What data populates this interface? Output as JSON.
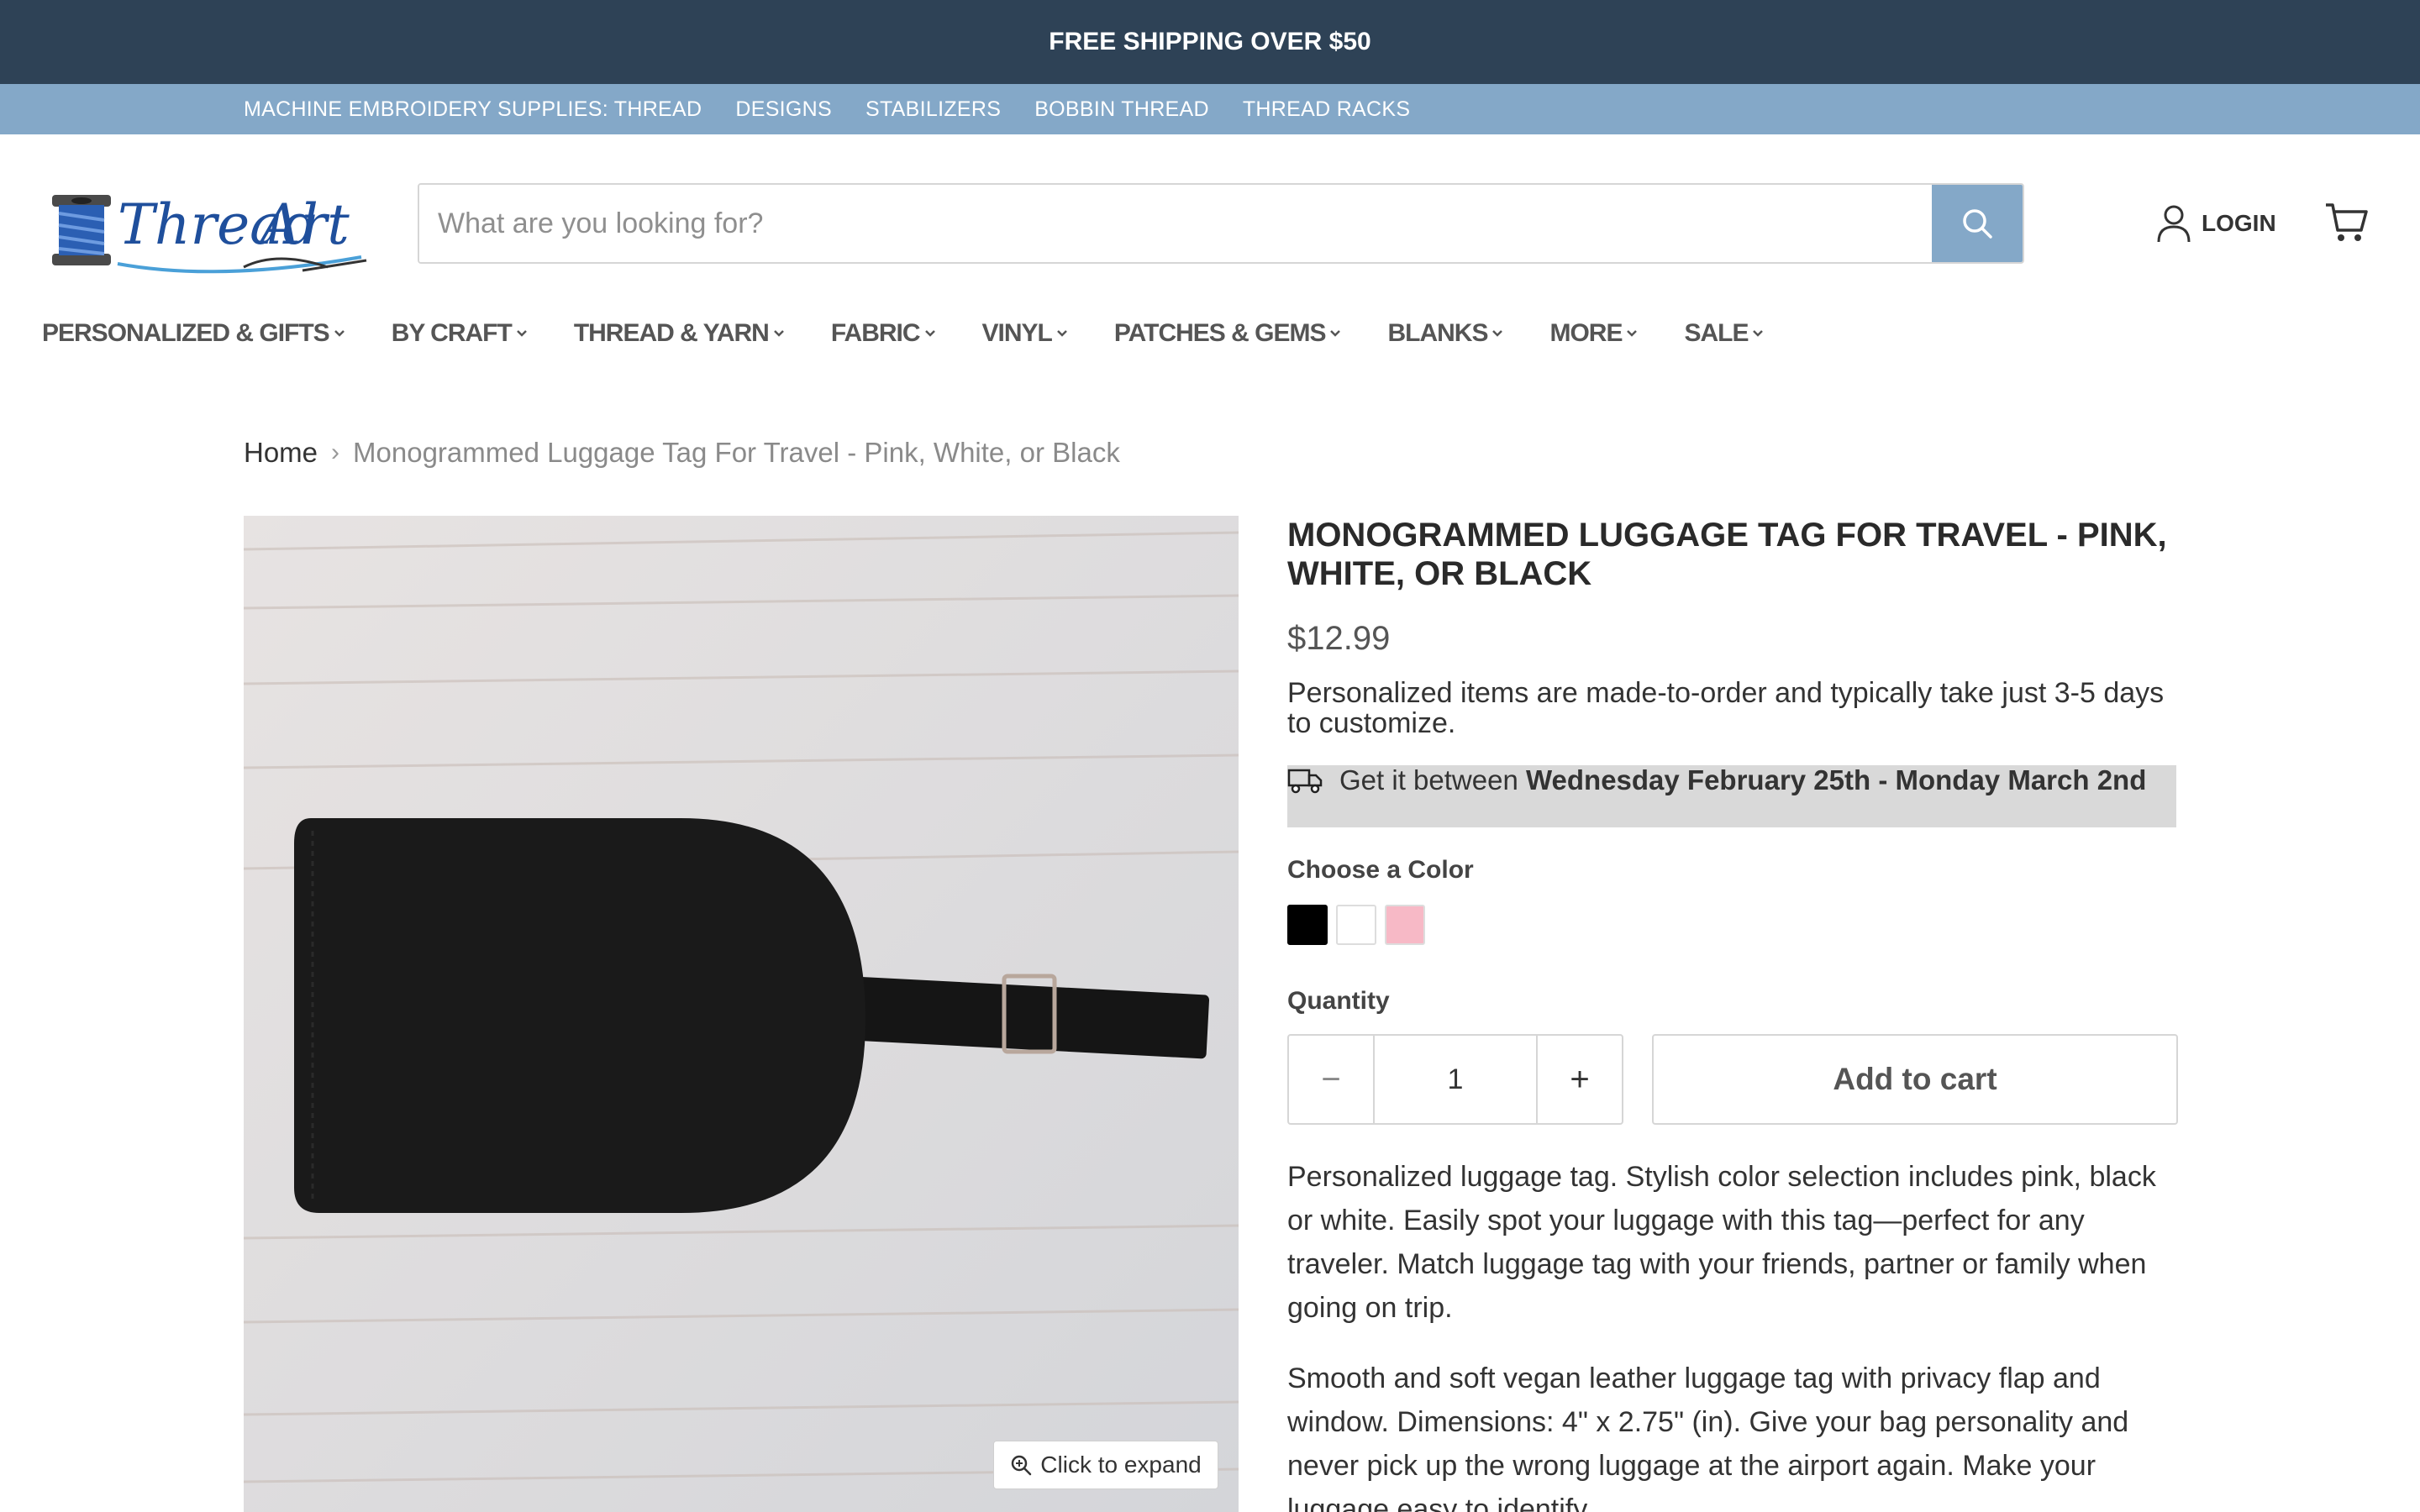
{
  "promo": {
    "text": "FREE SHIPPING OVER $50"
  },
  "sub_nav": [
    "MACHINE EMBROIDERY SUPPLIES: THREAD",
    "DESIGNS",
    "STABILIZERS",
    "BOBBIN THREAD",
    "THREAD RACKS"
  ],
  "header": {
    "logo_text": "ThreadArt",
    "search_placeholder": "What are you looking for?",
    "login_label": "LOGIN"
  },
  "main_nav": [
    "PERSONALIZED & GIFTS",
    "BY CRAFT",
    "THREAD & YARN",
    "FABRIC",
    "VINYL",
    "PATCHES & GEMS",
    "BLANKS",
    "MORE",
    "SALE"
  ],
  "breadcrumb": {
    "home": "Home",
    "separator": "›",
    "current": "Monogrammed Luggage Tag For Travel - Pink, White, or Black"
  },
  "product": {
    "title": "MONOGRAMMED LUGGAGE TAG FOR TRAVEL - PINK, WHITE, OR BLACK",
    "price": "$12.99",
    "made_note": "Personalized items are made-to-order and typically take just 3-5 days to customize.",
    "delivery_prefix": "Get it between ",
    "delivery_dates": "Wednesday February 25th - Monday March 2nd",
    "color_label": "Choose a Color",
    "colors": [
      "#000000",
      "#ffffff",
      "#f7b9c6"
    ],
    "quantity_label": "Quantity",
    "quantity": "1",
    "minus": "−",
    "plus": "+",
    "add_to_cart": "Add to cart",
    "expand_label": "Click to expand",
    "description": [
      "Personalized luggage tag. Stylish color selection includes pink, black or white. Easily spot your luggage with this tag—perfect for any traveler. Match luggage tag with your friends, partner or family when going on trip.",
      "Smooth and soft vegan leather luggage tag with privacy flap and window. Dimensions: 4\" x 2.75\" (in). Give your bag personality and never pick up the wrong luggage at the airport again. Make your luggage easy to identify."
    ]
  },
  "colors": {
    "promo_bg": "#2e4256",
    "subnav_bg": "#84a8c8",
    "accent": "#84a8c8"
  }
}
